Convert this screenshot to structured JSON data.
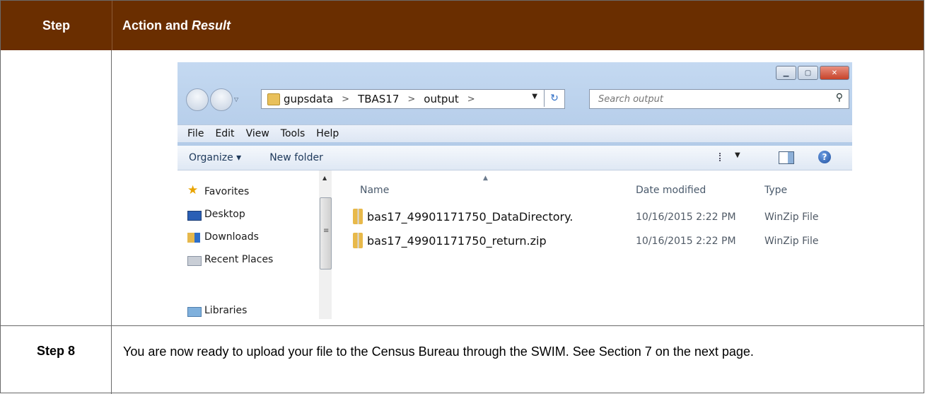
{
  "table": {
    "header": {
      "step": "Step",
      "action": "Action and",
      "result": "Result"
    },
    "step8": {
      "label": "Step 8",
      "text": "You are now ready to upload your file to the Census Bureau through the SWIM. See Section 7 on the next page."
    }
  },
  "explorer": {
    "address": {
      "segments": [
        "gupsdata",
        "TBAS17",
        "output"
      ],
      "separator": ">"
    },
    "search": {
      "placeholder": "Search output"
    },
    "menu": [
      "File",
      "Edit",
      "View",
      "Tools",
      "Help"
    ],
    "toolbar": {
      "organize": "Organize ▾",
      "new_folder": "New folder"
    },
    "nav": {
      "favorites": "Favorites",
      "desktop": "Desktop",
      "downloads": "Downloads",
      "recent": "Recent Places",
      "libraries": "Libraries"
    },
    "columns": {
      "name": "Name",
      "date": "Date modified",
      "type": "Type"
    },
    "files": [
      {
        "name": "bas17_49901171750_DataDirectory.",
        "date": "10/16/2015 2:22 PM",
        "type": "WinZip File"
      },
      {
        "name": "bas17_49901171750_return.zip",
        "date": "10/16/2015 2:22 PM",
        "type": "WinZip File"
      }
    ]
  }
}
